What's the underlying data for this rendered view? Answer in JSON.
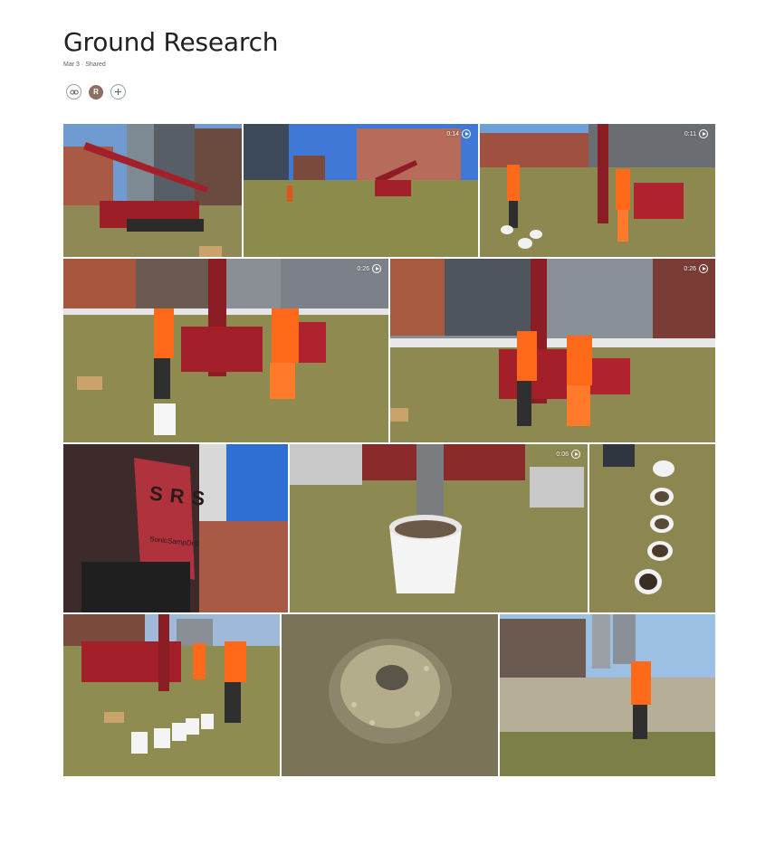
{
  "album": {
    "title": "Ground Research",
    "date": "Mar 3",
    "separator": "·",
    "status": "Shared"
  },
  "actions": {
    "link_icon": "link-icon",
    "avatar_initial": "R",
    "add_icon": "plus-icon"
  },
  "colors": {
    "sky": "#7aa6d8",
    "grass": "#8f8a4e",
    "machine": "#a3202b",
    "vest": "#ff6a1a",
    "building": "#9a5a45"
  },
  "photos": [
    {
      "name": "drill-rig-photo",
      "type": "photo"
    },
    {
      "name": "field-wide-video",
      "type": "video",
      "duration": "0:14"
    },
    {
      "name": "workers-buckets-video",
      "type": "video",
      "duration": "0:11"
    },
    {
      "name": "workers-rig-video-1",
      "type": "video",
      "duration": "0:26"
    },
    {
      "name": "workers-rig-video-2",
      "type": "video",
      "duration": "0:26"
    },
    {
      "name": "sonicsampdrill-sign-photo",
      "type": "photo",
      "sign_text": "SRS",
      "brand_text": "SonicSampDrill"
    },
    {
      "name": "bucket-sample-video",
      "type": "video",
      "duration": "0:06"
    },
    {
      "name": "sample-row-photo",
      "type": "photo"
    },
    {
      "name": "buckets-line-photo",
      "type": "photo"
    },
    {
      "name": "soil-pellets-photo",
      "type": "photo"
    },
    {
      "name": "worker-lot-photo",
      "type": "photo"
    }
  ]
}
